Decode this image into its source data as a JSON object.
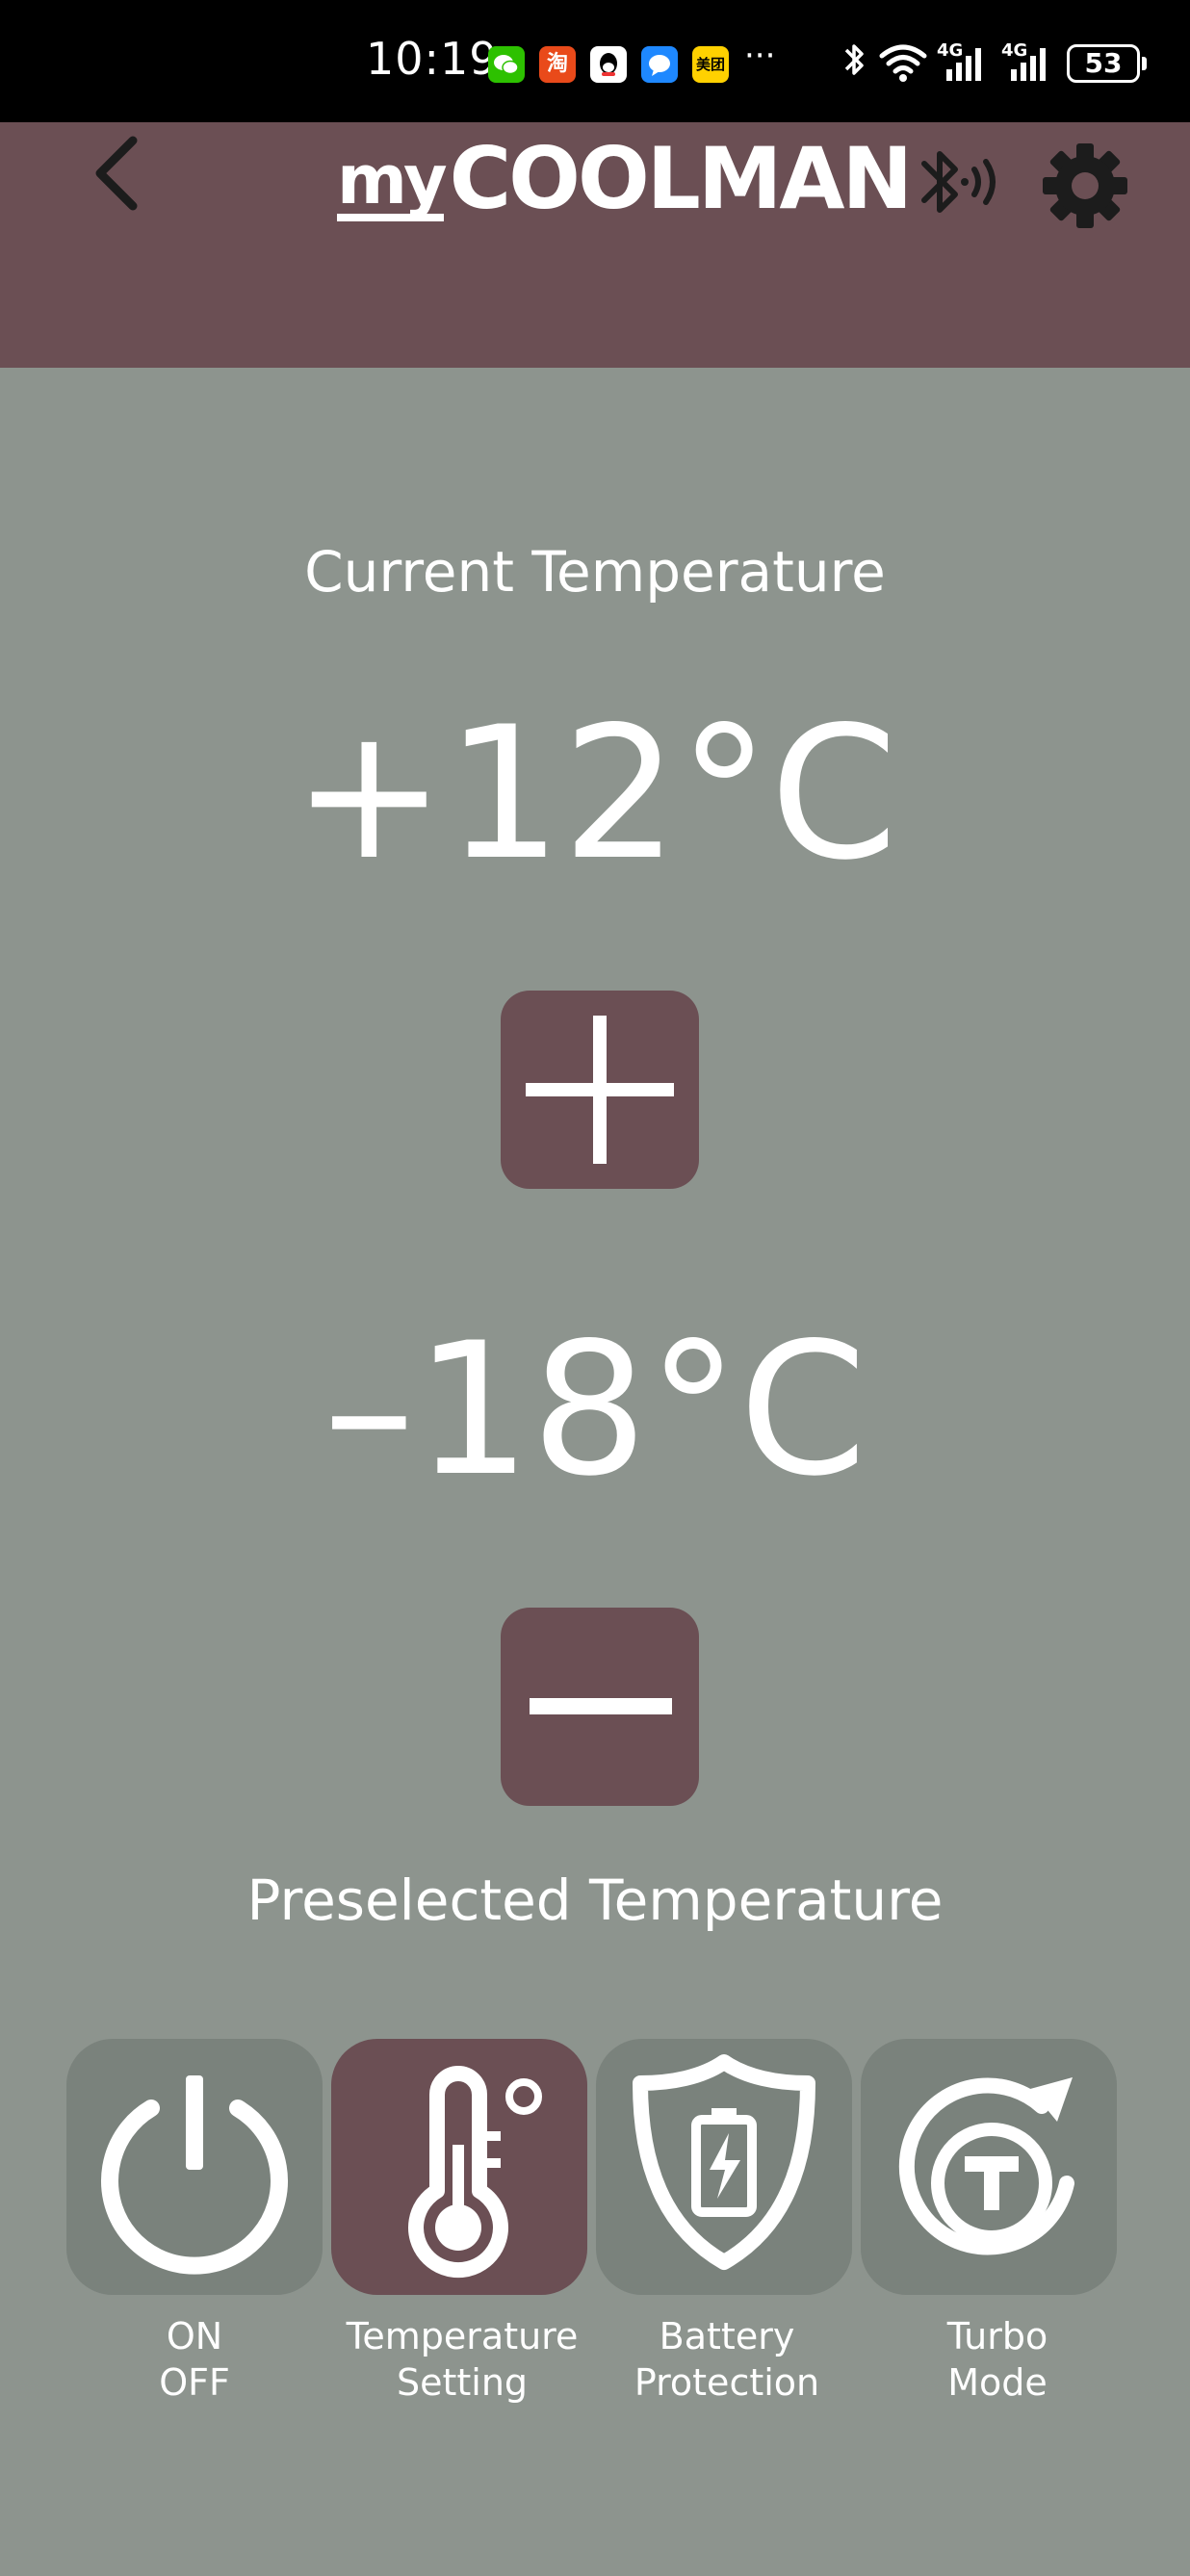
{
  "status_bar": {
    "time": "10:19",
    "apps": [
      {
        "name": "wechat-icon",
        "glyph": "✆",
        "color": "#2dc100"
      },
      {
        "name": "taobao-icon",
        "glyph": "淘",
        "color": "#e94a1a"
      },
      {
        "name": "qq-icon",
        "glyph": "◕",
        "color": "#ffffff"
      },
      {
        "name": "message-icon",
        "glyph": "●",
        "color": "#1e88ff"
      },
      {
        "name": "meituan-icon",
        "glyph": "美团",
        "color": "#ffd100"
      }
    ],
    "more": "···",
    "network1": "4G",
    "network2": "4G",
    "battery": "53"
  },
  "header": {
    "brand_my": "my",
    "brand_name": "COOLMAN"
  },
  "main": {
    "current_label": "Current Temperature",
    "current_temp": "+12°C",
    "preset_temp": "–18°C",
    "preset_label": "Preselected Temperature"
  },
  "modes": [
    {
      "line1": "ON",
      "line2": "OFF",
      "active": false
    },
    {
      "line1": "Temperature",
      "line2": "Setting",
      "active": true
    },
    {
      "line1": "Battery",
      "line2": "Protection",
      "active": false
    },
    {
      "line1": "Turbo",
      "line2": "Mode",
      "active": false
    }
  ],
  "colors": {
    "header_bg": "#6b4f54",
    "page_bg": "#8d948e",
    "tile_bg": "#7a827c",
    "accent": "#6b4f54"
  }
}
